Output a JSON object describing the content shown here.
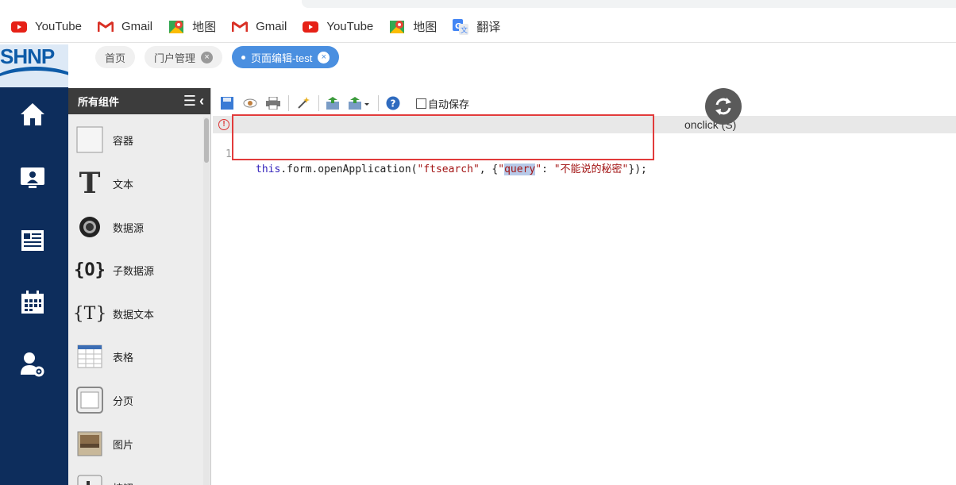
{
  "bookmarks": [
    {
      "label": "YouTube",
      "icon": "youtube-icon"
    },
    {
      "label": "Gmail",
      "icon": "gmail-icon"
    },
    {
      "label": "地图",
      "icon": "maps-icon"
    },
    {
      "label": "Gmail",
      "icon": "gmail-icon"
    },
    {
      "label": "YouTube",
      "icon": "youtube-icon"
    },
    {
      "label": "地图",
      "icon": "maps-icon"
    },
    {
      "label": "翻译",
      "icon": "translate-icon"
    }
  ],
  "logo": {
    "text": "SHNP"
  },
  "nav_icons": [
    "home-icon",
    "user-screen-icon",
    "news-icon",
    "calendar-icon",
    "user-settings-icon"
  ],
  "page_tabs": [
    {
      "label": "首页",
      "closable": false,
      "active": false
    },
    {
      "label": "门户管理",
      "closable": true,
      "active": false
    },
    {
      "label": "页面编辑-test",
      "closable": true,
      "active": true
    }
  ],
  "panel": {
    "title": "所有组件",
    "items": [
      {
        "label": "容器",
        "icon": "container-icon"
      },
      {
        "label": "文本",
        "icon": "text-icon"
      },
      {
        "label": "数据源",
        "icon": "datasource-icon"
      },
      {
        "label": "子数据源",
        "icon": "sub-datasource-icon"
      },
      {
        "label": "数据文本",
        "icon": "data-text-icon"
      },
      {
        "label": "表格",
        "icon": "table-icon"
      },
      {
        "label": "分页",
        "icon": "pagination-icon"
      },
      {
        "label": "图片",
        "icon": "image-icon"
      },
      {
        "label": "按钮",
        "icon": "button-icon"
      }
    ]
  },
  "toolbar": {
    "autosave_label": "自动保存"
  },
  "editor": {
    "event_label": "onclick (S)",
    "line_number": "1",
    "code": {
      "t1": "this",
      "t2": ".form.openApplication(",
      "t3": "\"ftsearch\"",
      "t4": ", {",
      "t5": "\"",
      "t6": "query",
      "t7": "\"",
      "t8": ": ",
      "t9": "\"不能说的秘密\"",
      "t10": "});"
    }
  },
  "colors": {
    "nav_bg": "#0d2d5c",
    "active_tab": "#4a8fe0",
    "annotation": "#e23b3b"
  }
}
